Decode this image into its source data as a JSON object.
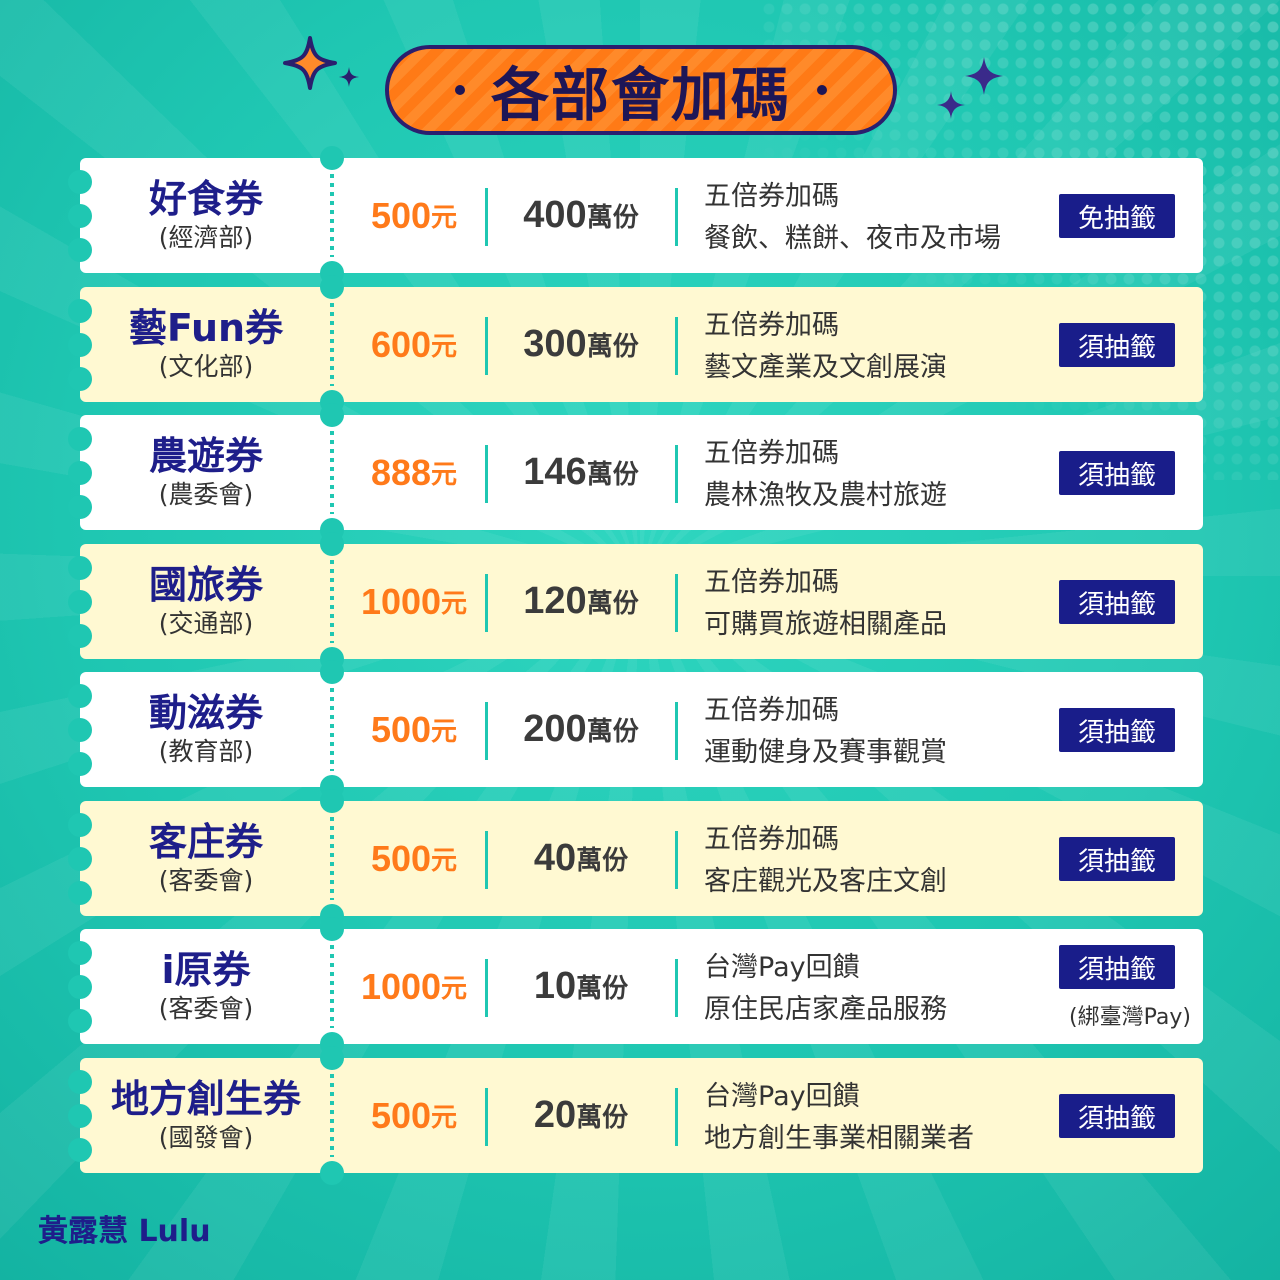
{
  "title": "各部會加碼",
  "colors": {
    "background": "#1fc7b2",
    "title_pill": "#ff7a16",
    "navy": "#191d8a",
    "amount_orange": "#ff7a1a",
    "row_cream": "#fff9d2"
  },
  "rows": [
    {
      "name": "好食券",
      "ministry": "(經濟部)",
      "amount": "500",
      "amount_unit": "元",
      "quantity": "400",
      "quantity_unit": "萬份",
      "desc1": "五倍券加碼",
      "desc2": "餐飲、糕餅、夜市及市場",
      "badge": "免抽籤",
      "note": ""
    },
    {
      "name": "藝Fun券",
      "ministry": "(文化部)",
      "amount": "600",
      "amount_unit": "元",
      "quantity": "300",
      "quantity_unit": "萬份",
      "desc1": "五倍券加碼",
      "desc2": "藝文產業及文創展演",
      "badge": "須抽籤",
      "note": ""
    },
    {
      "name": "農遊券",
      "ministry": "(農委會)",
      "amount": "888",
      "amount_unit": "元",
      "quantity": "146",
      "quantity_unit": "萬份",
      "desc1": "五倍券加碼",
      "desc2": "農林漁牧及農村旅遊",
      "badge": "須抽籤",
      "note": ""
    },
    {
      "name": "國旅券",
      "ministry": "(交通部)",
      "amount": "1000",
      "amount_unit": "元",
      "quantity": "120",
      "quantity_unit": "萬份",
      "desc1": "五倍券加碼",
      "desc2": "可購買旅遊相關產品",
      "badge": "須抽籤",
      "note": ""
    },
    {
      "name": "動滋券",
      "ministry": "(教育部)",
      "amount": "500",
      "amount_unit": "元",
      "quantity": "200",
      "quantity_unit": "萬份",
      "desc1": "五倍券加碼",
      "desc2": "運動健身及賽事觀賞",
      "badge": "須抽籤",
      "note": ""
    },
    {
      "name": "客庄券",
      "ministry": "(客委會)",
      "amount": "500",
      "amount_unit": "元",
      "quantity": "40",
      "quantity_unit": "萬份",
      "desc1": "五倍券加碼",
      "desc2": "客庄觀光及客庄文創",
      "badge": "須抽籤",
      "note": ""
    },
    {
      "name": "i原券",
      "ministry": "(客委會)",
      "amount": "1000",
      "amount_unit": "元",
      "quantity": "10",
      "quantity_unit": "萬份",
      "desc1": "台灣Pay回饋",
      "desc2": "原住民店家產品服務",
      "badge": "須抽籤",
      "note": "(綁臺灣Pay)"
    },
    {
      "name": "地方創生券",
      "ministry": "(國發會)",
      "amount": "500",
      "amount_unit": "元",
      "quantity": "20",
      "quantity_unit": "萬份",
      "desc1": "台灣Pay回饋",
      "desc2": "地方創生事業相關業者",
      "badge": "須抽籤",
      "note": ""
    }
  ],
  "footer": "黃露慧 Lulu"
}
